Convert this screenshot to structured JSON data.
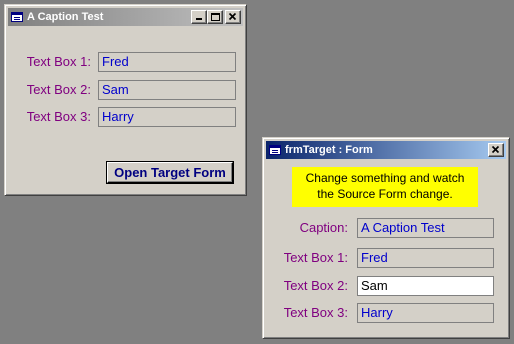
{
  "source_window": {
    "title": "A Caption Test",
    "fields": [
      {
        "label": "Text Box 1:",
        "value": "Fred"
      },
      {
        "label": "Text Box 2:",
        "value": "Sam"
      },
      {
        "label": "Text Box 3:",
        "value": "Harry"
      }
    ],
    "open_button_label": "Open Target Form"
  },
  "target_window": {
    "title": "frmTarget : Form",
    "note_line1": "Change something and watch",
    "note_line2": "the Source Form change.",
    "caption_label": "Caption:",
    "caption_value": "A Caption Test",
    "fields": [
      {
        "label": "Text Box 1:",
        "value": "Fred"
      },
      {
        "label": "Text Box 2:",
        "value": "Sam"
      },
      {
        "label": "Text Box 3:",
        "value": "Harry"
      }
    ]
  },
  "colors": {
    "desktop": "#808080",
    "window_face": "#d4d0c8",
    "label_text": "#800080",
    "field_text": "#0000cc",
    "note_background": "#ffff00",
    "active_title": "#0a246a",
    "inactive_title": "#808080"
  },
  "icons": [
    "form-icon",
    "minimize-icon",
    "maximize-icon",
    "close-icon"
  ]
}
